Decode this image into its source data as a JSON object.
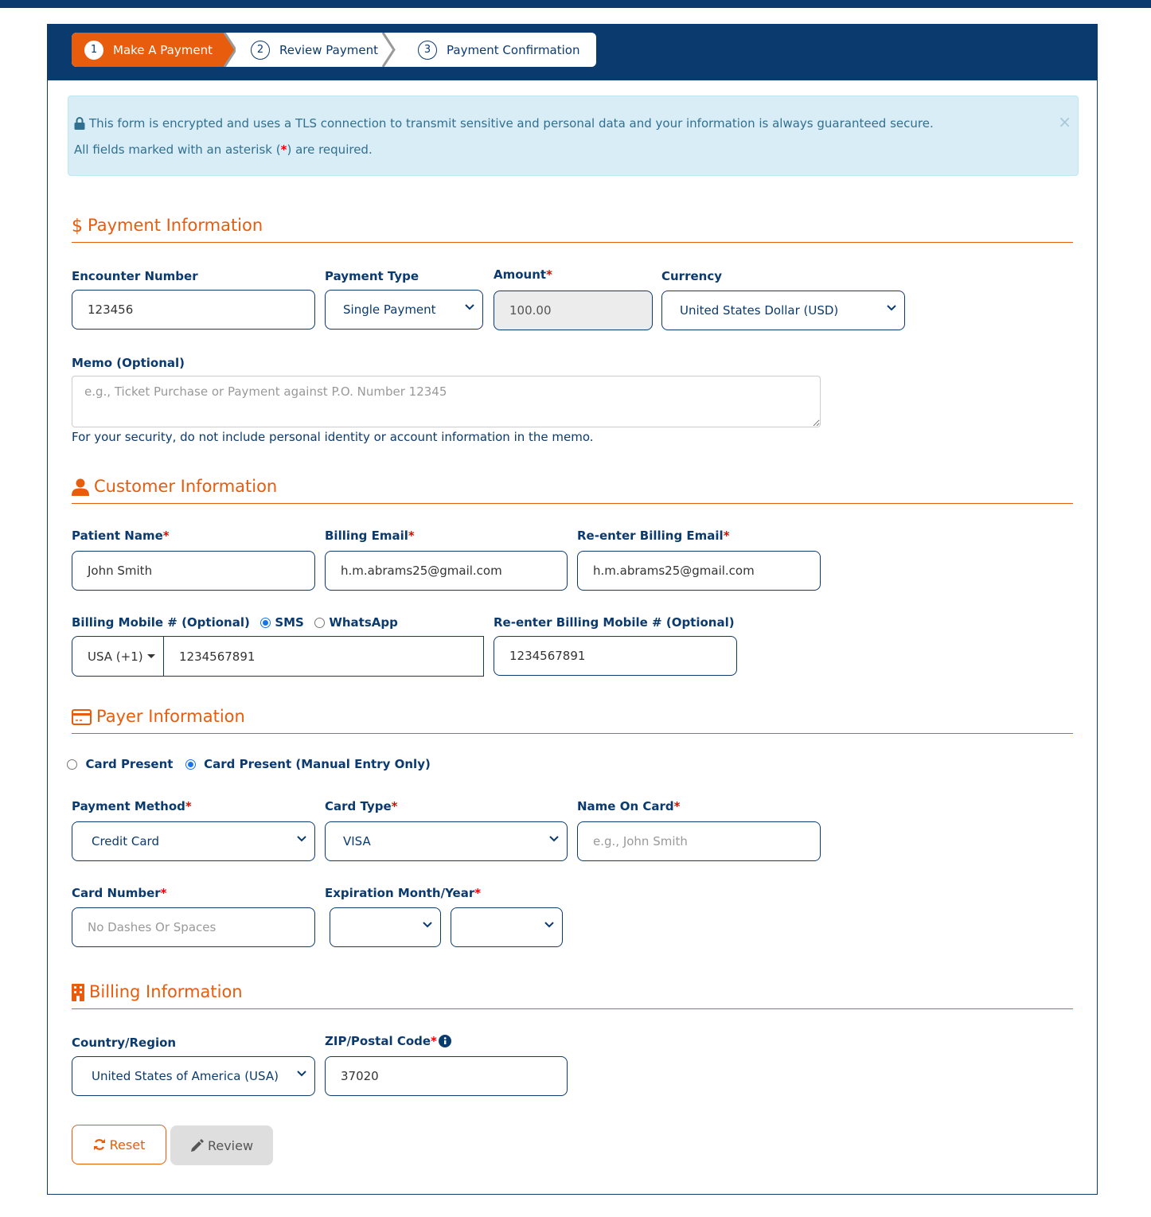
{
  "stepper": {
    "steps": [
      {
        "number": "1",
        "label": "Make A Payment",
        "active": true
      },
      {
        "number": "2",
        "label": "Review Payment",
        "active": false
      },
      {
        "number": "3",
        "label": "Payment Confirmation",
        "active": false
      }
    ]
  },
  "alert": {
    "line1": "This form is encrypted and uses a TLS connection to transmit sensitive and personal data and your information is always guaranteed secure.",
    "line2_prefix": "All fields marked with an asterisk (",
    "line2_asterisk": "*",
    "line2_suffix": ") are required.",
    "close": "×"
  },
  "colors": {
    "brand_navy": "#0b3a6e",
    "accent_orange": "#e85c0d",
    "required_red": "#ee0000",
    "alert_bg": "#d9edf7"
  },
  "payment": {
    "title": "Payment Information",
    "encounter_label": "Encounter Number",
    "encounter_value": "123456",
    "payment_type_label": "Payment Type",
    "payment_type_value": "Single Payment",
    "amount_label": "Amount",
    "amount_value": "100.00",
    "currency_label": "Currency",
    "currency_value": "United States Dollar (USD)",
    "memo_label": "Memo (Optional)",
    "memo_placeholder": "e.g., Ticket Purchase or Payment against P.O. Number 12345",
    "memo_help": "For your security, do not include personal identity or account information in the memo."
  },
  "customer": {
    "title": "Customer Information",
    "patient_name_label": "Patient Name",
    "patient_name_value": "John Smith",
    "billing_email_label": "Billing Email",
    "billing_email_value": "h.m.abrams25@gmail.com",
    "reenter_email_label": "Re-enter Billing Email",
    "reenter_email_value": "h.m.abrams25@gmail.com",
    "mobile_label": "Billing Mobile # (Optional)",
    "mobile_channel_sms": "SMS",
    "mobile_channel_whatsapp": "WhatsApp",
    "mobile_channel_selected": "SMS",
    "country_code": "USA (+1)",
    "mobile_value": "1234567891",
    "reenter_mobile_label": "Re-enter Billing Mobile # (Optional)",
    "reenter_mobile_value": "1234567891"
  },
  "payer": {
    "title": "Payer Information",
    "mode_card_present": "Card Present",
    "mode_manual": "Card Present (Manual Entry Only)",
    "mode_selected": "Card Present (Manual Entry Only)",
    "payment_method_label": "Payment Method",
    "payment_method_value": "Credit Card",
    "card_type_label": "Card Type",
    "card_type_value": "VISA",
    "name_on_card_label": "Name On Card",
    "name_on_card_placeholder": "e.g., John Smith",
    "card_number_label": "Card Number",
    "card_number_placeholder": "No Dashes Or Spaces",
    "expiration_label": "Expiration Month/Year",
    "exp_month_value": "",
    "exp_year_value": ""
  },
  "billing": {
    "title": "Billing Information",
    "country_label": "Country/Region",
    "country_value": "United States of America (USA)",
    "zip_label": "ZIP/Postal Code",
    "zip_value": "37020"
  },
  "buttons": {
    "reset": "Reset",
    "review": "Review"
  },
  "required_mark": "*"
}
